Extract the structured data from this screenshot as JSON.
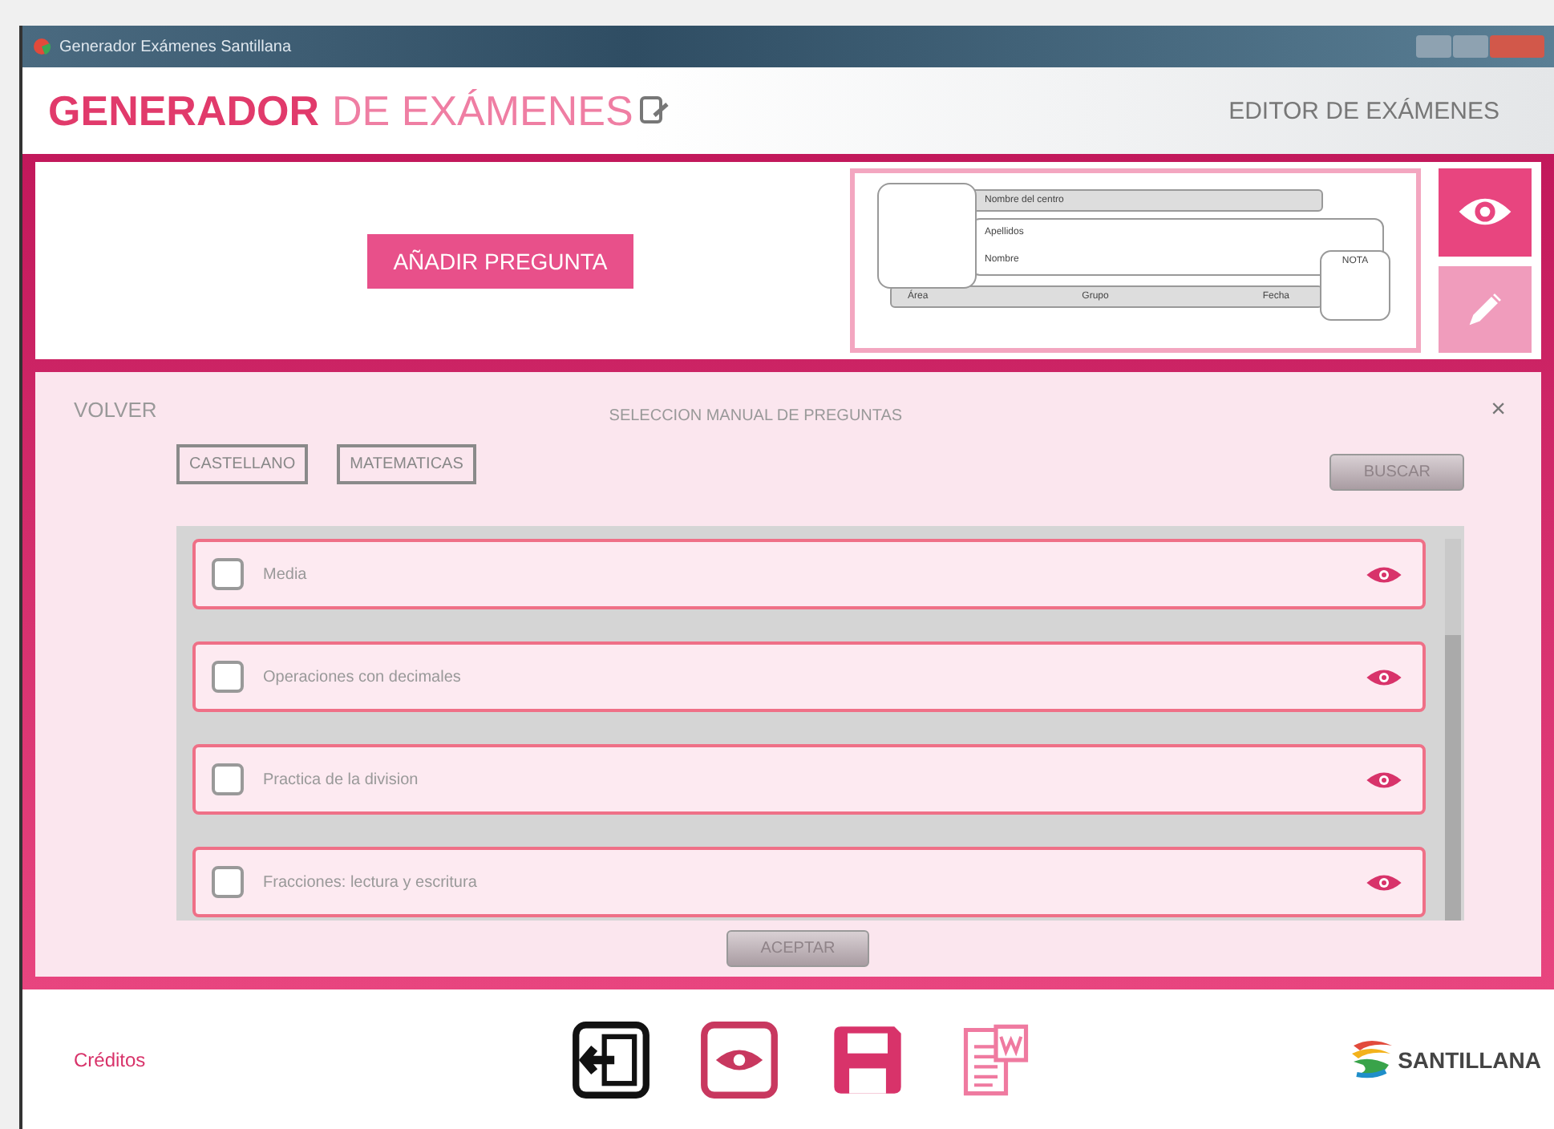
{
  "window": {
    "title": "Generador Exámenes Santillana"
  },
  "header": {
    "title_strong": "GENERADOR",
    "title_light": "DE EXÁMENES",
    "section": "EDITOR DE EXÁMENES"
  },
  "top_panel": {
    "add_button": "AÑADIR PREGUNTA",
    "preview": {
      "center_label": "Nombre del centro",
      "surname_label": "Apellidos",
      "name_label": "Nombre",
      "grade_label": "NOTA",
      "area_label": "Área",
      "group_label": "Grupo",
      "date_label": "Fecha"
    }
  },
  "selection": {
    "back": "VOLVER",
    "title": "SELECCION MANUAL DE PREGUNTAS",
    "close": "×",
    "subjects": [
      {
        "label": "CASTELLANO"
      },
      {
        "label": "MATEMATICAS"
      }
    ],
    "search_button": "BUSCAR",
    "questions": [
      {
        "label": "Media",
        "checked": false
      },
      {
        "label": "Operaciones con decimales",
        "checked": false
      },
      {
        "label": "Practica de la division",
        "checked": false
      },
      {
        "label": "Fracciones: lectura y escritura",
        "checked": false
      }
    ],
    "accept_button": "ACEPTAR"
  },
  "footer": {
    "credits": "Créditos",
    "brand": "SANTILLANA"
  }
}
